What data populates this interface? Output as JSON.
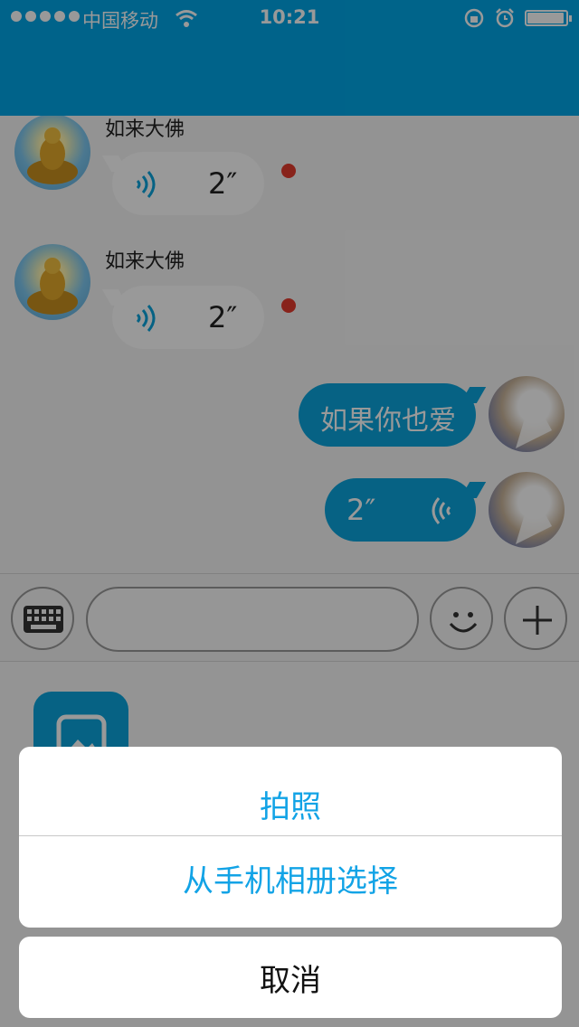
{
  "status_bar": {
    "carrier": "中国移动",
    "time": "10:21",
    "battery_level": 0.9,
    "icons": [
      "signal-dots-icon",
      "wifi-icon",
      "rotation-lock-icon",
      "alarm-icon",
      "battery-icon"
    ]
  },
  "messages": [
    {
      "direction": "incoming",
      "sender": "如来大佛",
      "type": "voice",
      "duration": "2″",
      "unread": true
    },
    {
      "direction": "incoming",
      "sender": "如来大佛",
      "type": "voice",
      "duration": "2″",
      "unread": true
    },
    {
      "direction": "outgoing",
      "type": "text",
      "text": "如果你也爱"
    },
    {
      "direction": "outgoing",
      "type": "voice",
      "duration": "2″"
    }
  ],
  "input_bar": {
    "icons": [
      "keyboard-icon",
      "emoji-icon",
      "plus-icon"
    ],
    "text_value": ""
  },
  "panel": {
    "icons": [
      "photo-album-icon"
    ]
  },
  "action_sheet": {
    "take_photo": "拍照",
    "choose_from_album": "从手机相册选择",
    "cancel": "取消"
  },
  "colors": {
    "accent": "#00a6e6",
    "action_text": "#12a3e6",
    "unread_dot": "#e33b2e"
  }
}
